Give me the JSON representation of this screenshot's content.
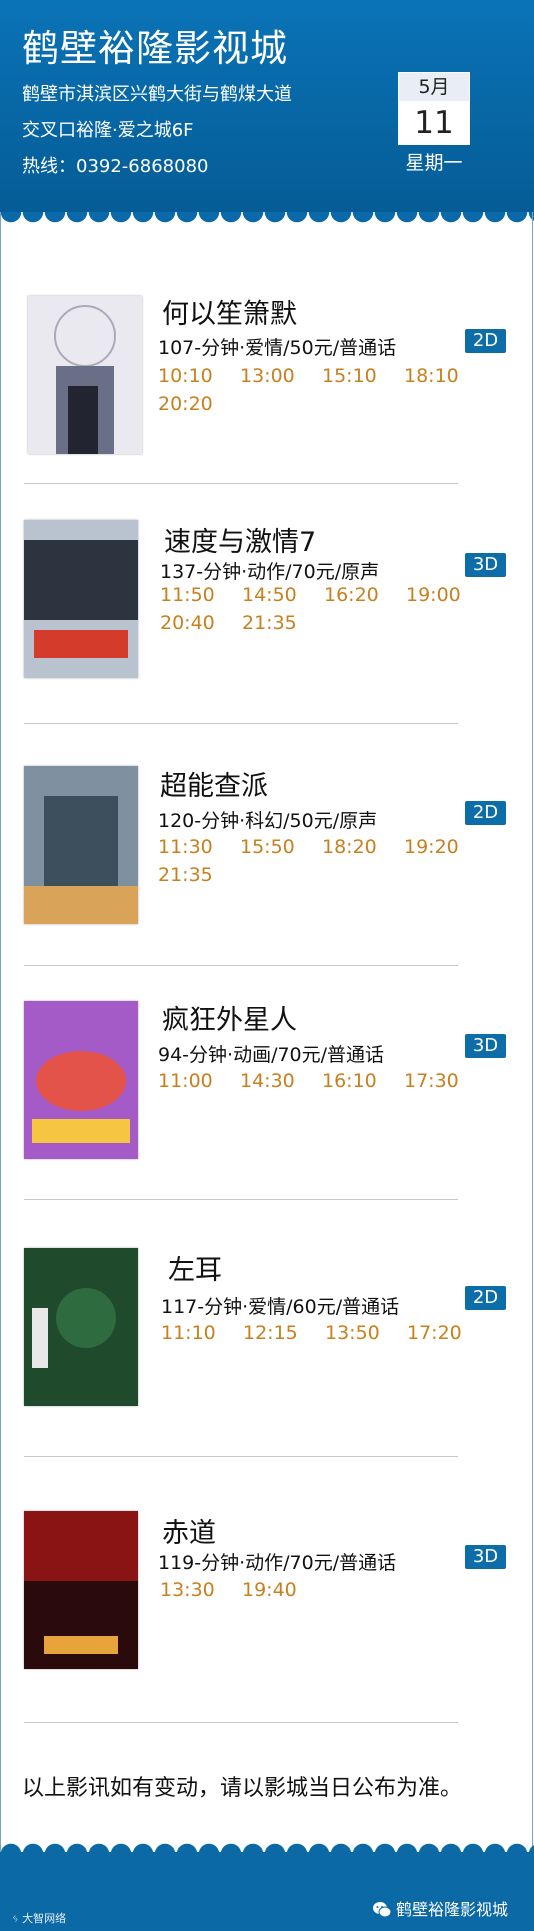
{
  "header": {
    "title": "鹤壁裕隆影视城",
    "address_line1": "鹤壁市淇滨区兴鹤大街与鹤煤大道",
    "address_line2": "交叉口裕隆·爱之城6F",
    "hotline": "热线：0392-6868080",
    "date_month": "5月",
    "date_day": "11",
    "weekday": "星期一"
  },
  "movies": [
    {
      "title": "何以笙箫默",
      "info": "107-分钟·爱情/50元/普通话",
      "format": "2D",
      "times": [
        "10:10",
        "13:00",
        "15:10",
        "18:10",
        "20:20"
      ]
    },
    {
      "title": "速度与激情7",
      "info": "137-分钟·动作/70元/原声",
      "format": "3D",
      "times": [
        "11:50",
        "14:50",
        "16:20",
        "19:00",
        "20:40",
        "21:35"
      ]
    },
    {
      "title": "超能查派",
      "info": "120-分钟·科幻/50元/原声",
      "format": "2D",
      "times": [
        "11:30",
        "15:50",
        "18:20",
        "19:20",
        "21:35"
      ]
    },
    {
      "title": "疯狂外星人",
      "info": "94-分钟·动画/70元/普通话",
      "format": "3D",
      "times": [
        "11:00",
        "14:30",
        "16:10",
        "17:30"
      ]
    },
    {
      "title": "左耳",
      "info": "117-分钟·爱情/60元/普通话",
      "format": "2D",
      "times": [
        "11:10",
        "12:15",
        "13:50",
        "17:20"
      ]
    },
    {
      "title": "赤道",
      "info": "119-分钟·动作/70元/普通话",
      "format": "3D",
      "times": [
        "13:30",
        "19:40"
      ]
    }
  ],
  "posters": [
    {
      "text": "何以笙箫默",
      "colors": [
        "#e9e9ef",
        "#6a6f88",
        "#22252f"
      ]
    },
    {
      "text": "速度与激情7",
      "colors": [
        "#b9c3cf",
        "#2c3440",
        "#d43b2a"
      ]
    },
    {
      "text": "超能查派",
      "colors": [
        "#7f91a1",
        "#3d4e5c",
        "#d9a45a"
      ]
    },
    {
      "text": "疯狂外星人",
      "colors": [
        "#a45ac7",
        "#e3534a",
        "#f6c542"
      ]
    },
    {
      "text": "左耳",
      "colors": [
        "#1f4a2c",
        "#2e6b3e",
        "#e8e8e8"
      ]
    },
    {
      "text": "赤道",
      "colors": [
        "#8a1414",
        "#2a0a0a",
        "#e7a43a"
      ]
    }
  ],
  "notice": "以上影讯如有变动，请以影城当日公布为准。",
  "footer": {
    "wechat_name": "鹤壁裕隆影视城",
    "watermark": "大智网络"
  },
  "colors": {
    "header_blue": "#0a73b7",
    "time_orange": "#c8801e",
    "badge_blue": "#0d6da8"
  }
}
